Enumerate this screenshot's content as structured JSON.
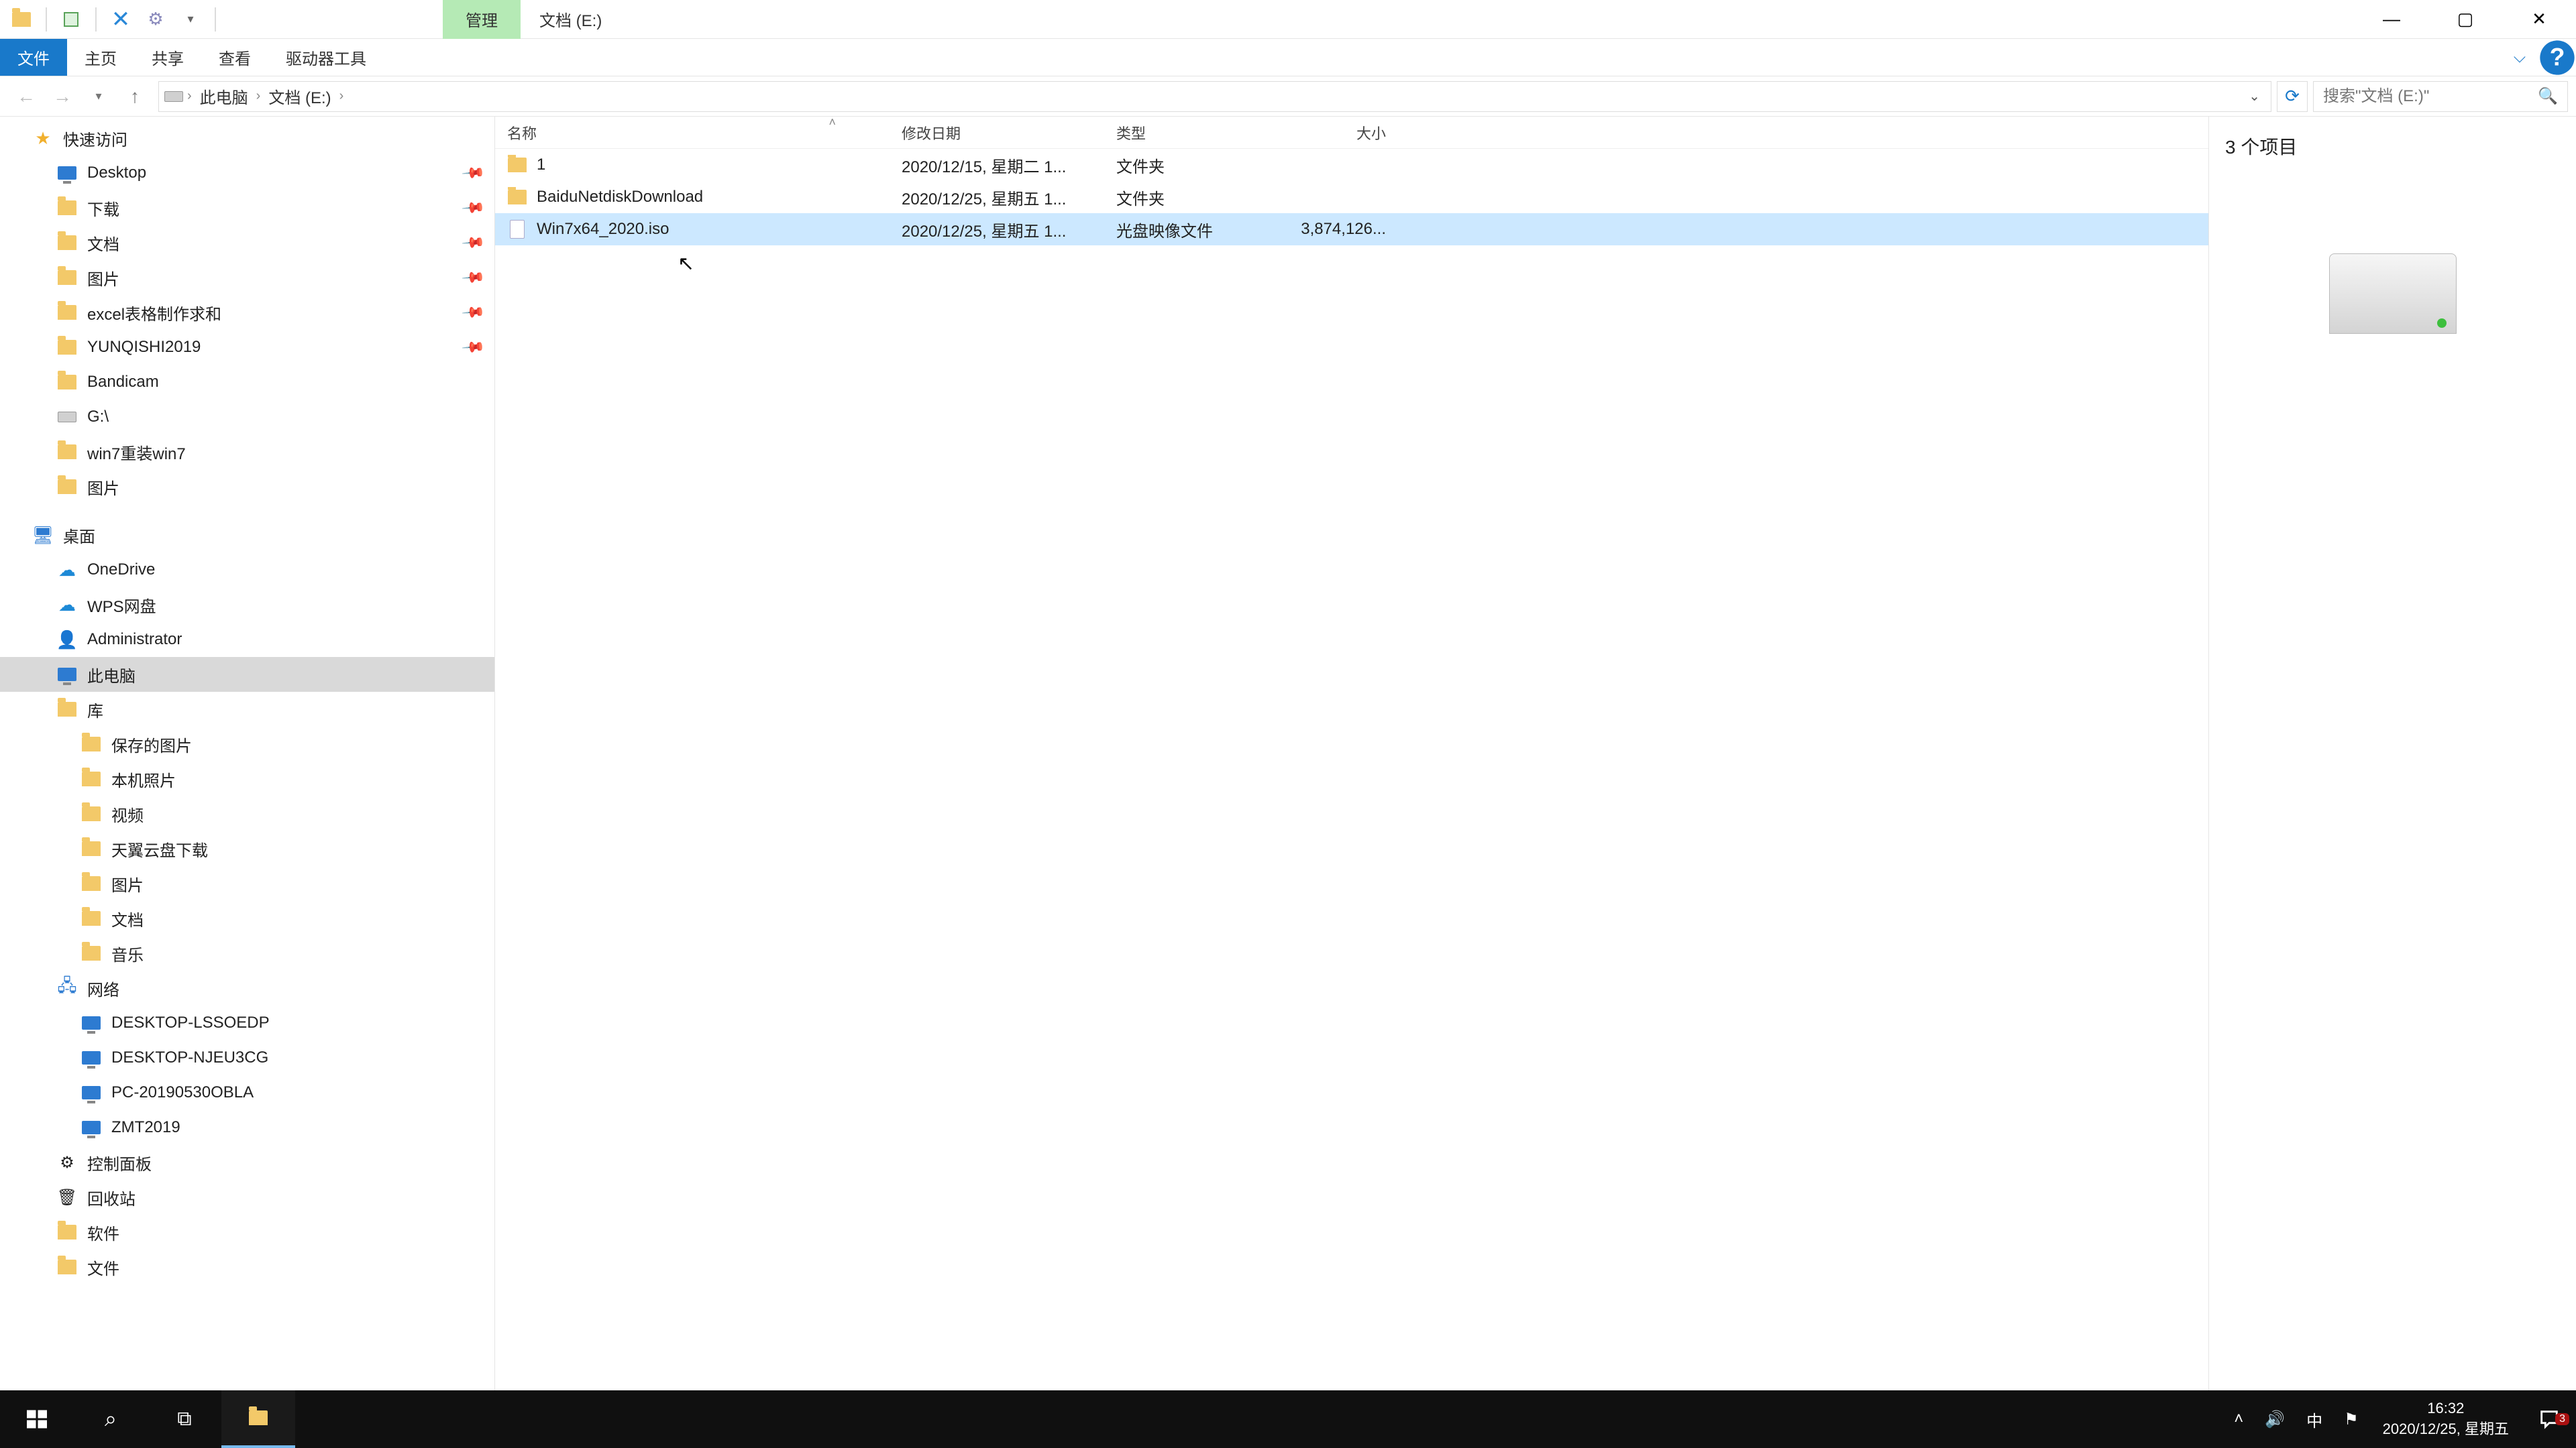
{
  "title_context_tab": "管理",
  "window_title": "文档 (E:)",
  "ribbon": {
    "file": "文件",
    "home": "主页",
    "share": "共享",
    "view": "查看",
    "drive_tools": "驱动器工具"
  },
  "breadcrumbs": [
    "此电脑",
    "文档 (E:)"
  ],
  "search_placeholder": "搜索\"文档 (E:)\"",
  "columns": {
    "name": "名称",
    "date": "修改日期",
    "type": "类型",
    "size": "大小"
  },
  "files": [
    {
      "name": "1",
      "date": "2020/12/15, 星期二 1...",
      "type": "文件夹",
      "size": "",
      "icon": "folder",
      "selected": false
    },
    {
      "name": "BaiduNetdiskDownload",
      "date": "2020/12/25, 星期五 1...",
      "type": "文件夹",
      "size": "",
      "icon": "folder",
      "selected": false
    },
    {
      "name": "Win7x64_2020.iso",
      "date": "2020/12/25, 星期五 1...",
      "type": "光盘映像文件",
      "size": "3,874,126...",
      "icon": "file",
      "selected": true
    }
  ],
  "nav": {
    "quick_access": "快速访问",
    "quick_items": [
      {
        "l": "Desktop",
        "icon": "pc",
        "pin": true
      },
      {
        "l": "下载",
        "icon": "folder",
        "pin": true
      },
      {
        "l": "文档",
        "icon": "folder",
        "pin": true
      },
      {
        "l": "图片",
        "icon": "folder",
        "pin": true
      },
      {
        "l": "excel表格制作求和",
        "icon": "folder",
        "pin": true
      },
      {
        "l": "YUNQISHI2019",
        "icon": "folder",
        "pin": true
      },
      {
        "l": "Bandicam",
        "icon": "folder",
        "pin": false
      },
      {
        "l": "G:\\",
        "icon": "drive",
        "pin": false
      },
      {
        "l": "win7重装win7",
        "icon": "folder",
        "pin": false
      },
      {
        "l": "图片",
        "icon": "folder",
        "pin": false
      }
    ],
    "desktop": "桌面",
    "desktop_items": [
      {
        "l": "OneDrive",
        "icon": "cloud"
      },
      {
        "l": "WPS网盘",
        "icon": "cloud"
      },
      {
        "l": "Administrator",
        "icon": "user"
      },
      {
        "l": "此电脑",
        "icon": "pc",
        "selected": true
      },
      {
        "l": "库",
        "icon": "folder"
      }
    ],
    "libs": [
      {
        "l": "保存的图片"
      },
      {
        "l": "本机照片"
      },
      {
        "l": "视频"
      },
      {
        "l": "天翼云盘下载"
      },
      {
        "l": "图片"
      },
      {
        "l": "文档"
      },
      {
        "l": "音乐"
      }
    ],
    "network": "网络",
    "network_items": [
      {
        "l": "DESKTOP-LSSOEDP"
      },
      {
        "l": "DESKTOP-NJEU3CG"
      },
      {
        "l": "PC-20190530OBLA"
      },
      {
        "l": "ZMT2019"
      }
    ],
    "trailing": [
      {
        "l": "控制面板",
        "icon": "panel"
      },
      {
        "l": "回收站",
        "icon": "bin"
      },
      {
        "l": "软件",
        "icon": "folder"
      },
      {
        "l": "文件",
        "icon": "folder"
      }
    ]
  },
  "preview_count": "3 个项目",
  "status_text": "3 个项目",
  "taskbar": {
    "time": "16:32",
    "date": "2020/12/25, 星期五",
    "ime": "中",
    "notif_count": "3"
  }
}
